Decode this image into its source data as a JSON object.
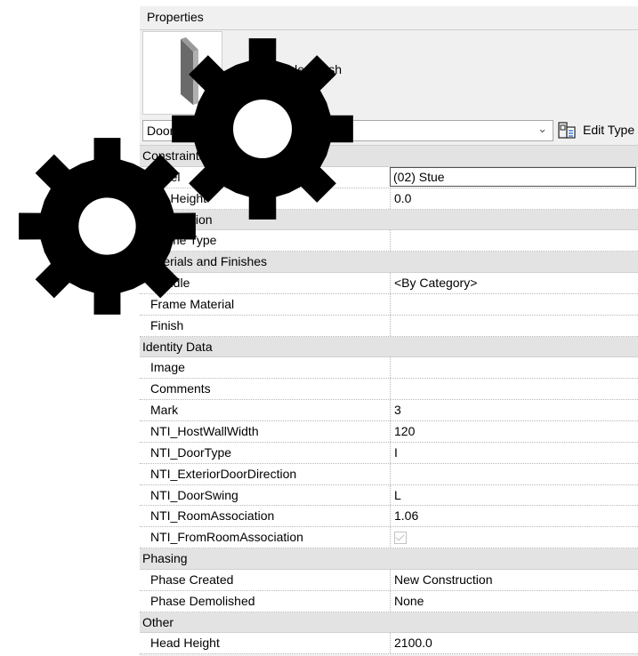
{
  "panel": {
    "title": "Properties",
    "type_name": "Door_Single_Flush",
    "selector_value": "Doors (1)",
    "edit_type_label": "Edit Type",
    "edit_type_icon": "edit-type-icon",
    "dropdown_icon": "chevron-down-icon"
  },
  "rows": [
    {
      "kind": "cat",
      "label": "Constraints"
    },
    {
      "kind": "prop",
      "name": "Level",
      "value": "(02) Stue",
      "editing": true
    },
    {
      "kind": "prop",
      "name": "Sill Height",
      "value": "0.0"
    },
    {
      "kind": "cat",
      "label": "Construction"
    },
    {
      "kind": "prop",
      "name": "Frame Type",
      "value": ""
    },
    {
      "kind": "cat",
      "label": "Materials and Finishes"
    },
    {
      "kind": "prop",
      "name": "Handle",
      "value": "<By Category>"
    },
    {
      "kind": "prop",
      "name": "Frame Material",
      "value": ""
    },
    {
      "kind": "prop",
      "name": "Finish",
      "value": ""
    },
    {
      "kind": "cat",
      "label": "Identity Data"
    },
    {
      "kind": "prop",
      "name": "Image",
      "value": ""
    },
    {
      "kind": "prop",
      "name": "Comments",
      "value": ""
    },
    {
      "kind": "prop",
      "name": "Mark",
      "value": "3"
    },
    {
      "kind": "prop",
      "name": "NTI_HostWallWidth",
      "value": "120"
    },
    {
      "kind": "prop",
      "name": "NTI_DoorType",
      "value": "I"
    },
    {
      "kind": "prop",
      "name": "NTI_ExteriorDoorDirection",
      "value": ""
    },
    {
      "kind": "prop",
      "name": "NTI_DoorSwing",
      "value": "L"
    },
    {
      "kind": "prop",
      "name": "NTI_RoomAssociation",
      "value": "1.06"
    },
    {
      "kind": "prop",
      "name": "NTI_FromRoomAssociation",
      "value": "",
      "checkbox": true,
      "checked": true
    },
    {
      "kind": "cat",
      "label": "Phasing"
    },
    {
      "kind": "prop",
      "name": "Phase Created",
      "value": "New Construction"
    },
    {
      "kind": "prop",
      "name": "Phase Demolished",
      "value": "None"
    },
    {
      "kind": "cat",
      "label": "Other"
    },
    {
      "kind": "prop",
      "name": "Head Height",
      "value": "2100.0"
    }
  ],
  "overlays": {
    "gear_color": "#000000",
    "icon": "gear-icon"
  }
}
